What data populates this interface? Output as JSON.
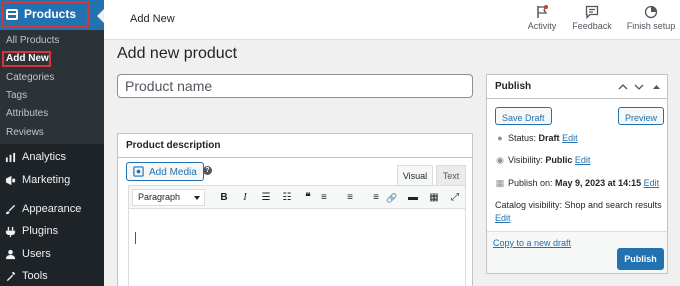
{
  "sidebar": {
    "products_label": "Products",
    "submenu": [
      "All Products",
      "Add New",
      "Categories",
      "Tags",
      "Attributes",
      "Reviews"
    ],
    "menu": [
      {
        "label": "Analytics",
        "icon": "bar-chart-icon"
      },
      {
        "label": "Marketing",
        "icon": "megaphone-icon"
      },
      {
        "label": "Appearance",
        "icon": "paintbrush-icon"
      },
      {
        "label": "Plugins",
        "icon": "plug-icon"
      },
      {
        "label": "Users",
        "icon": "users-icon"
      },
      {
        "label": "Tools",
        "icon": "wrench-icon"
      }
    ]
  },
  "topbar": {
    "page_label": "Add New",
    "actions": {
      "activity": "Activity",
      "feedback": "Feedback",
      "finish_setup": "Finish setup"
    }
  },
  "main": {
    "title": "Add new product",
    "product_name_placeholder": "Product name",
    "description": {
      "heading": "Product description",
      "add_media": "Add Media",
      "tab_visual": "Visual",
      "tab_text": "Text",
      "format": "Paragraph",
      "tools": {
        "bold": "B",
        "italic": "I",
        "bullets": "☰",
        "numbers": "☷",
        "quote": "❝",
        "align_left": "≡",
        "align_center": "≡",
        "align_right": "≡",
        "link": "🔗",
        "more": "▬",
        "kitchen": "▦",
        "fullscreen": "⤢"
      }
    }
  },
  "publish": {
    "heading": "Publish",
    "save_draft": "Save Draft",
    "preview": "Preview",
    "status_label": "Status:",
    "status_value": "Draft",
    "visibility_label": "Visibility:",
    "visibility_value": "Public",
    "publish_on_label": "Publish on:",
    "publish_on_value": "May 9, 2023 at 14:15",
    "edit": "Edit",
    "catalog_text": "Catalog visibility: Shop and search results",
    "copy_draft": "Copy to a new draft",
    "publish_button": "Publish"
  },
  "colors": {
    "accent": "#2271b1",
    "sidebar": "#1d2327",
    "highlight": "#d63638"
  }
}
